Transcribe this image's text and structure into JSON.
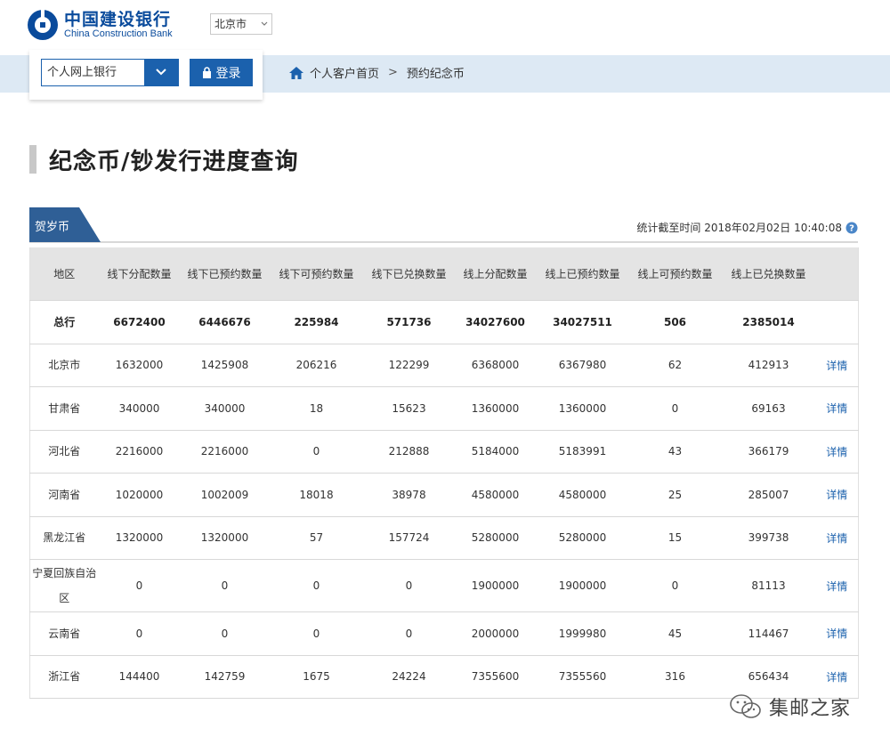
{
  "header": {
    "logo_cn": "中国建设银行",
    "logo_en": "China Construction Bank",
    "city": "北京市"
  },
  "login": {
    "bank_type": "个人网上银行",
    "login_label": "登录"
  },
  "breadcrumb": {
    "home": "个人客户首页",
    "separator": ">",
    "current": "预约纪念币"
  },
  "page_title": "纪念币/钞发行进度查询",
  "tab": {
    "label": "贺岁币"
  },
  "stat_time": "统计截至时间 2018年02月02日 10:40:08",
  "table": {
    "headers": [
      "地区",
      "线下分配数量",
      "线下已预约数量",
      "线下可预约数量",
      "线下已兑换数量",
      "线上分配数量",
      "线上已预约数量",
      "线上可预约数量",
      "线上已兑换数量",
      ""
    ],
    "total": [
      "总行",
      "6672400",
      "6446676",
      "225984",
      "571736",
      "34027600",
      "34027511",
      "506",
      "2385014",
      ""
    ],
    "detail_label": "详情",
    "rows": [
      [
        "北京市",
        "1632000",
        "1425908",
        "206216",
        "122299",
        "6368000",
        "6367980",
        "62",
        "412913"
      ],
      [
        "甘肃省",
        "340000",
        "340000",
        "18",
        "15623",
        "1360000",
        "1360000",
        "0",
        "69163"
      ],
      [
        "河北省",
        "2216000",
        "2216000",
        "0",
        "212888",
        "5184000",
        "5183991",
        "43",
        "366179"
      ],
      [
        "河南省",
        "1020000",
        "1002009",
        "18018",
        "38978",
        "4580000",
        "4580000",
        "25",
        "285007"
      ],
      [
        "黑龙江省",
        "1320000",
        "1320000",
        "57",
        "157724",
        "5280000",
        "5280000",
        "15",
        "399738"
      ],
      [
        "宁夏回族自治区",
        "0",
        "0",
        "0",
        "0",
        "1900000",
        "1900000",
        "0",
        "81113"
      ],
      [
        "云南省",
        "0",
        "0",
        "0",
        "0",
        "2000000",
        "1999980",
        "45",
        "114467"
      ],
      [
        "浙江省",
        "144400",
        "142759",
        "1675",
        "24224",
        "7355600",
        "7355560",
        "316",
        "656434"
      ]
    ]
  },
  "watermark": "集邮之家",
  "colors": {
    "brand_blue": "#1b61ad",
    "logo_blue": "#0a4b9c",
    "band": "#dde9f4",
    "tab": "#2f5f96"
  }
}
